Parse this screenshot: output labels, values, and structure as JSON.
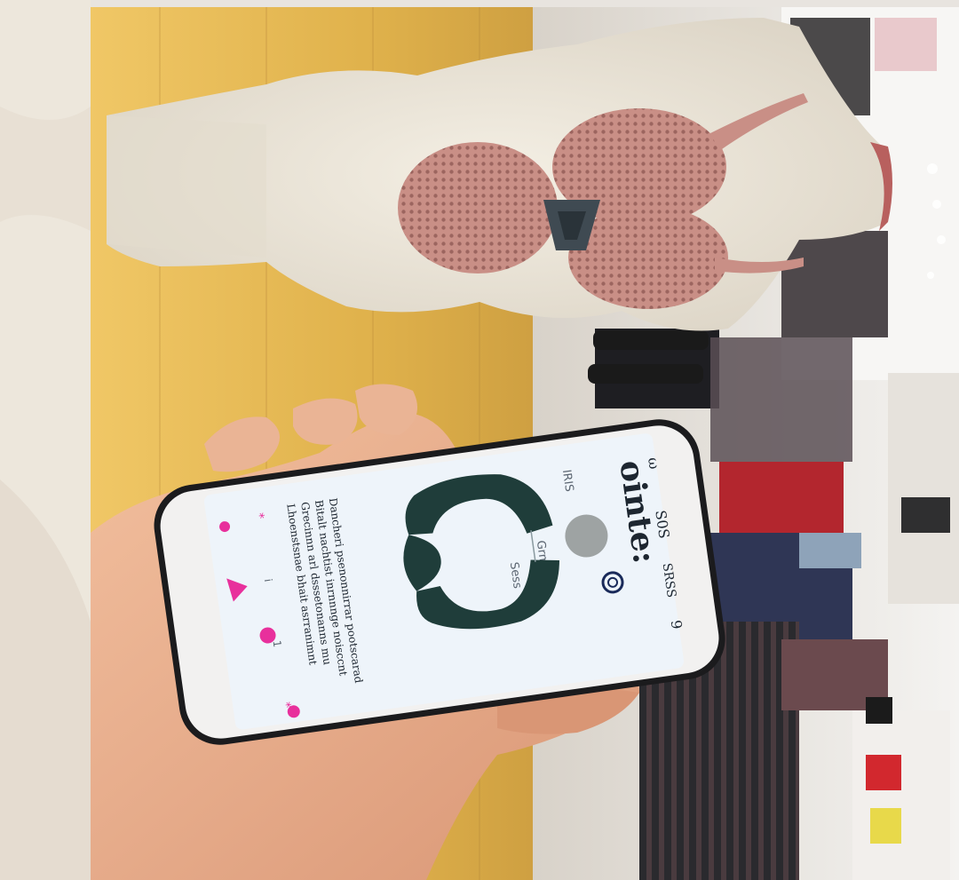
{
  "photo": {
    "subject": "smartphone-app-scan-of-mannequin",
    "colors": {
      "floor": "#e0b24c",
      "mannequin": "#ebe4d6",
      "mesh": "#c98f86",
      "phone_body": "#f2f1f0",
      "phone_screen": "#eef4fa",
      "garment_shape": "#1f3d3a",
      "accent": "#e8309c",
      "skin": "#e7ac8a"
    }
  },
  "phone_screen": {
    "title": "ointe:",
    "top_icons": [
      "ω",
      "S0S",
      "SRSS",
      "9"
    ],
    "tab_left": "IRIS",
    "tab_mid": "Grms",
    "tab_right": "Sess",
    "body_lines": [
      "Dancheri psenonnirrar pootscarad",
      "Bitalt nachtist inrnnnge noisccnt",
      "Grecinnn arl dsssetonanns mu",
      "Lhoenstsnae bhait asrranimnt"
    ],
    "bottom_markers": [
      "*",
      "i",
      "1",
      "*"
    ]
  }
}
